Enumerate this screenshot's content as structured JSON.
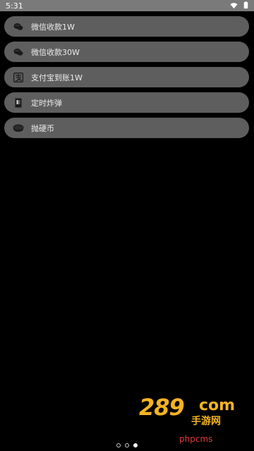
{
  "status": {
    "time": "5:31",
    "icons": [
      "wifi-icon",
      "battery-icon"
    ]
  },
  "items": [
    {
      "label": "微信收款1W",
      "icon": "wechat-icon"
    },
    {
      "label": "微信收款30W",
      "icon": "wechat-icon"
    },
    {
      "label": "支付宝到账1W",
      "icon": "alipay-icon"
    },
    {
      "label": "定时炸弹",
      "icon": "timer-icon"
    },
    {
      "label": "抛硬币",
      "icon": "coin-icon"
    }
  ],
  "watermark": {
    "brand": "289",
    "domain": "com",
    "subtitle": "手游网",
    "cms": "phpcms"
  },
  "pager": {
    "count": 3,
    "active_index": 2
  },
  "colors": {
    "item_background": "#5e5e5e",
    "status_bar": "#7a7a7a",
    "watermark": "#f5b321",
    "cms_text": "#e23b3b"
  }
}
